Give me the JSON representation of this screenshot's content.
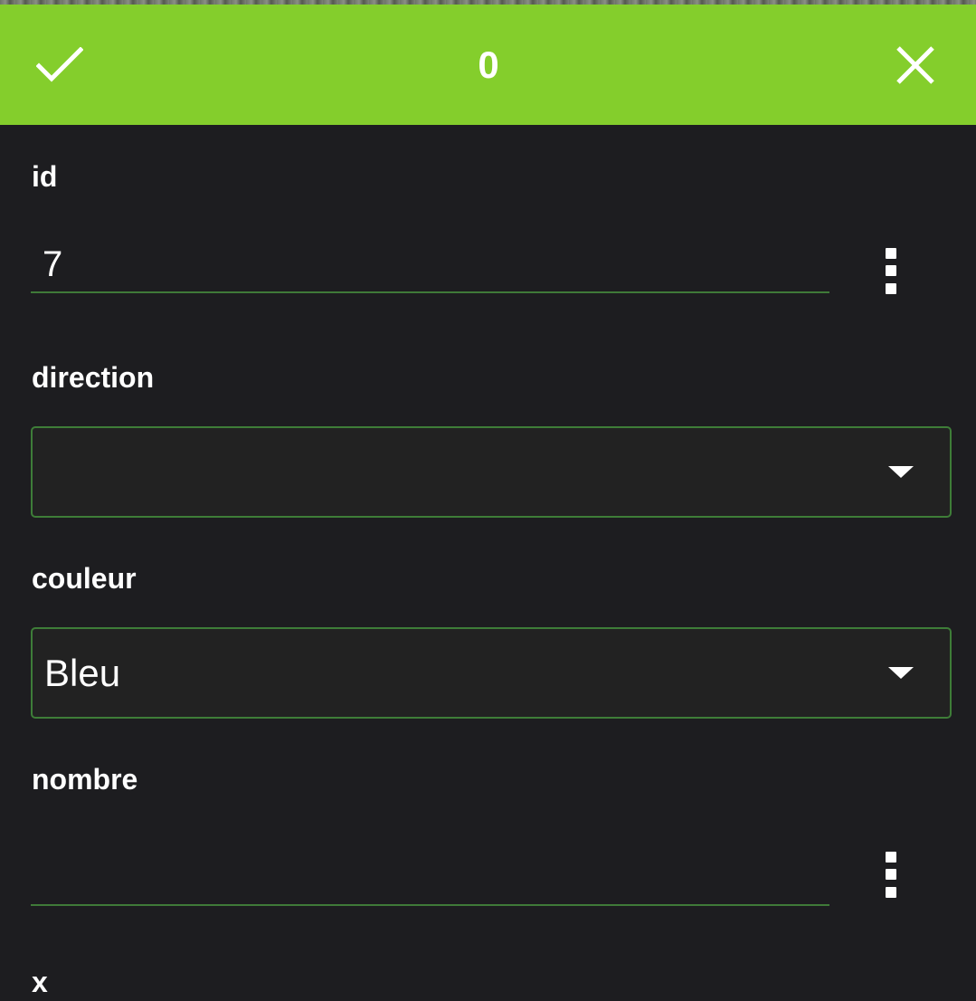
{
  "header": {
    "title": "0",
    "confirm_icon": "check-icon",
    "cancel_icon": "close-icon",
    "background_color": "#84ce2c"
  },
  "form": {
    "fields": [
      {
        "label": "id",
        "type": "text",
        "value": "7",
        "menu_icon": "more-vertical-icon"
      },
      {
        "label": "direction",
        "type": "select",
        "value": "",
        "icon": "caret-down-icon"
      },
      {
        "label": "couleur",
        "type": "select",
        "value": "Bleu",
        "icon": "caret-down-icon"
      },
      {
        "label": "nombre",
        "type": "text",
        "value": "",
        "menu_icon": "more-vertical-icon"
      },
      {
        "label": "x"
      }
    ]
  },
  "colors": {
    "background": "#1d1d20",
    "field_border": "#3e7d38",
    "select_fill": "#222222"
  }
}
